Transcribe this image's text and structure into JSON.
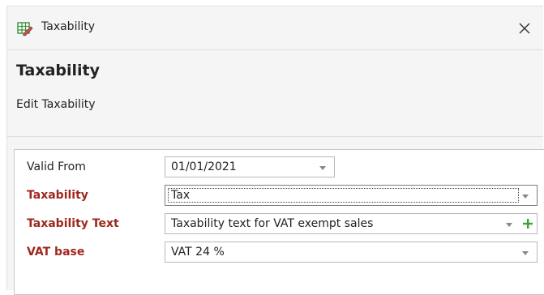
{
  "window": {
    "title": "Taxability",
    "icon": "table-edit-icon",
    "close_icon": "close-icon"
  },
  "header": {
    "title": "Taxability",
    "subtitle": "Edit Taxability"
  },
  "form": {
    "valid_from": {
      "label": "Valid From",
      "value": "01/01/2021"
    },
    "taxability": {
      "label": "Taxability",
      "value": "Tax"
    },
    "taxability_text": {
      "label": "Taxability Text",
      "value": "Taxability text for VAT exempt sales"
    },
    "vat_base": {
      "label": "VAT base",
      "value": "VAT 24 %"
    }
  },
  "colors": {
    "required_label": "#a0271f",
    "add_icon": "#3aa53a",
    "background": "#f5f5f5"
  }
}
